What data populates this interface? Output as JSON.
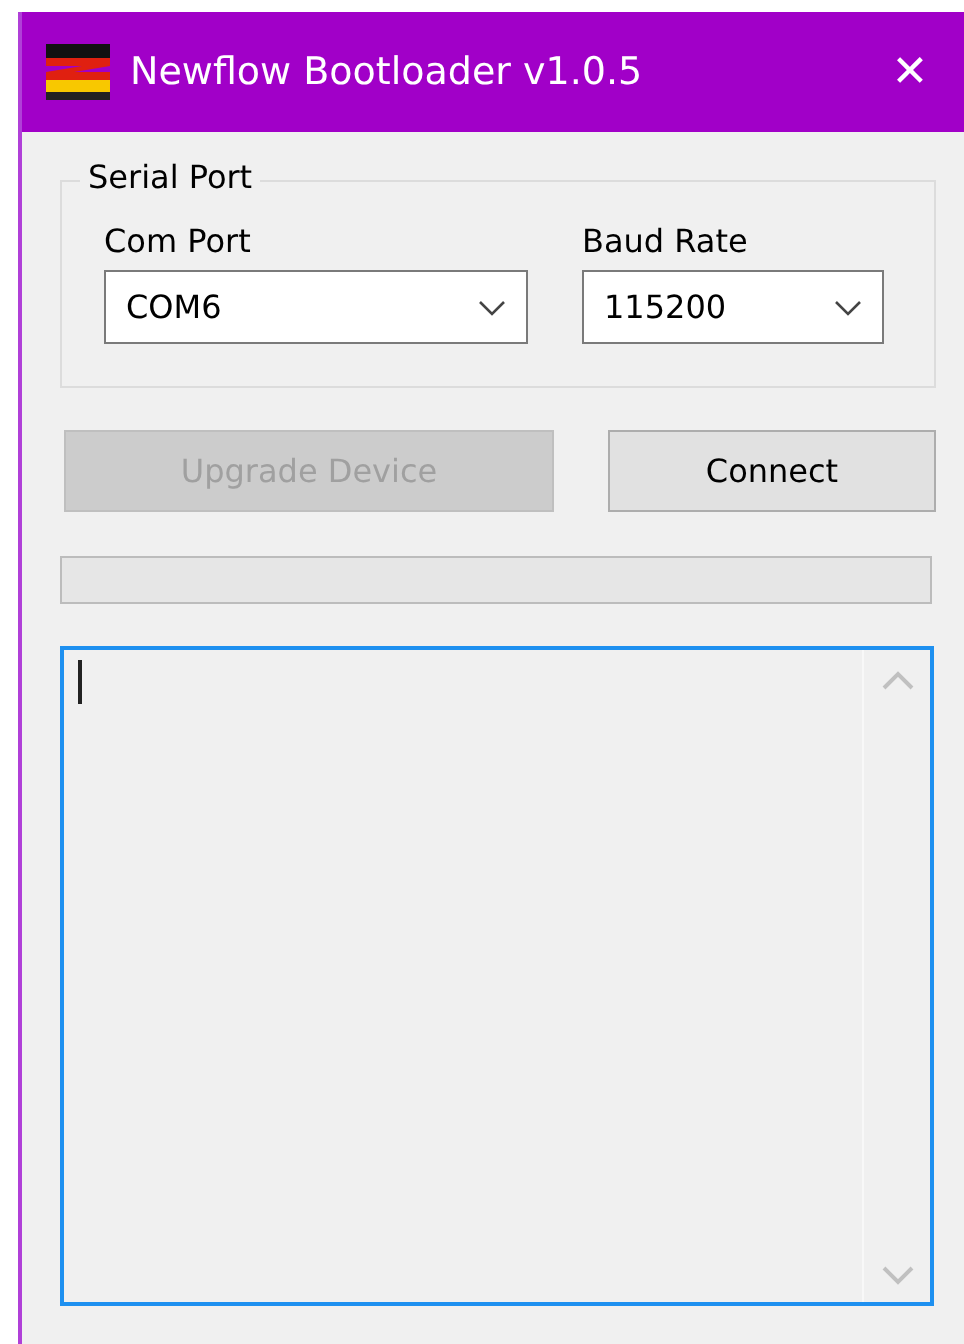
{
  "window": {
    "title": "Newflow Bootloader v1.0.5",
    "close": "✕"
  },
  "serial_port": {
    "title": "Serial Port",
    "fields": [
      {
        "label": "Com Port",
        "value": "COM6"
      },
      {
        "label": "Baud Rate",
        "value": "115200"
      }
    ]
  },
  "buttons": [
    {
      "label": "Upgrade Device",
      "disabled": true
    },
    {
      "label": "Connect",
      "disabled": false
    }
  ],
  "progress": {
    "level": 0
  },
  "log": {
    "focused": true
  }
}
